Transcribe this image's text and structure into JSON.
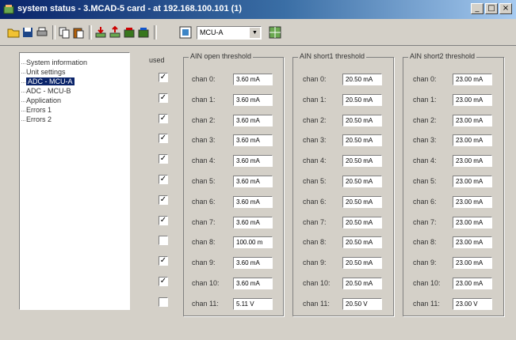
{
  "window": {
    "title": "system status - 3.MCAD-5 card - at 192.168.100.101 (1)"
  },
  "toolbar": {
    "buttons": [
      "open-icon",
      "save-icon",
      "print-icon",
      "copy-icon",
      "paste-icon",
      "read-icon",
      "write-icon",
      "send-icon",
      "receive-icon",
      "device-icon"
    ],
    "module_select": "MCU-A",
    "extra_button": "grid-icon"
  },
  "tree": {
    "items": [
      {
        "label": "System information",
        "selected": false
      },
      {
        "label": "Unit settings",
        "selected": false
      },
      {
        "label": "ADC - MCU-A",
        "selected": true
      },
      {
        "label": "ADC - MCU-B",
        "selected": false
      },
      {
        "label": "Application",
        "selected": false
      },
      {
        "label": "Errors 1",
        "selected": false
      },
      {
        "label": "Errors 2",
        "selected": false
      }
    ]
  },
  "used_label": "used",
  "channels": [
    {
      "label": "chan 0:",
      "used": true,
      "open": "3.60 mA",
      "short1": "20.50 mA",
      "short2": "23.00 mA"
    },
    {
      "label": "chan 1:",
      "used": true,
      "open": "3.60 mA",
      "short1": "20.50 mA",
      "short2": "23.00 mA"
    },
    {
      "label": "chan 2:",
      "used": true,
      "open": "3.60 mA",
      "short1": "20.50 mA",
      "short2": "23.00 mA"
    },
    {
      "label": "chan 3:",
      "used": true,
      "open": "3.60 mA",
      "short1": "20.50 mA",
      "short2": "23.00 mA"
    },
    {
      "label": "chan 4:",
      "used": true,
      "open": "3.60 mA",
      "short1": "20.50 mA",
      "short2": "23.00 mA"
    },
    {
      "label": "chan 5:",
      "used": true,
      "open": "3.60 mA",
      "short1": "20.50 mA",
      "short2": "23.00 mA"
    },
    {
      "label": "chan 6:",
      "used": true,
      "open": "3.60 mA",
      "short1": "20.50 mA",
      "short2": "23.00 mA"
    },
    {
      "label": "chan 7:",
      "used": true,
      "open": "3.60 mA",
      "short1": "20.50 mA",
      "short2": "23.00 mA"
    },
    {
      "label": "chan 8:",
      "used": false,
      "open": "100.00 m",
      "short1": "20.50 mA",
      "short2": "23.00 mA"
    },
    {
      "label": "chan 9:",
      "used": true,
      "open": "3.60 mA",
      "short1": "20.50 mA",
      "short2": "23.00 mA"
    },
    {
      "label": "chan 10:",
      "used": true,
      "open": "3.60 mA",
      "short1": "20.50 mA",
      "short2": "23.00 mA"
    },
    {
      "label": "chan 11:",
      "used": false,
      "open": "5.11 V",
      "short1": "20.50 V",
      "short2": "23.00 V"
    }
  ],
  "groups": {
    "open": {
      "title": "AIN open threshold"
    },
    "short1": {
      "title": "AIN short1 threshold"
    },
    "short2": {
      "title": "AIN short2 threshold"
    }
  },
  "checkmark": "✓",
  "colors": {
    "selection": "#0a246a",
    "titlebar": "#0a246a",
    "face": "#d4d0c8"
  }
}
